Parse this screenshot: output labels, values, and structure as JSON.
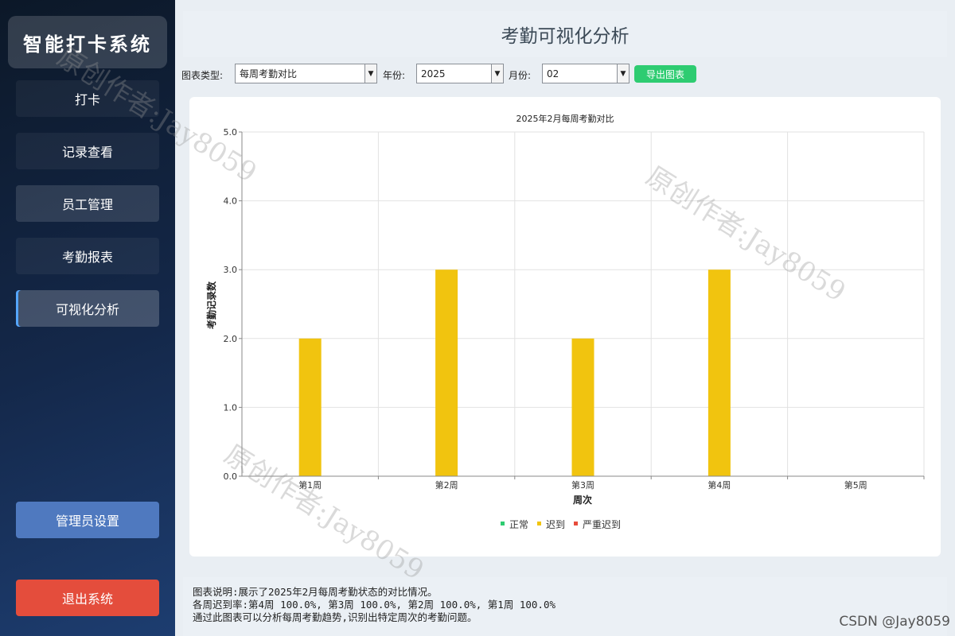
{
  "sidebar": {
    "title": "智能打卡系统",
    "items": [
      {
        "label": "打卡"
      },
      {
        "label": "记录查看"
      },
      {
        "label": "员工管理"
      },
      {
        "label": "考勤报表"
      },
      {
        "label": "可视化分析"
      }
    ],
    "admin_label": "管理员设置",
    "logout_label": "退出系统"
  },
  "header": {
    "title": "考勤可视化分析"
  },
  "toolbar": {
    "chart_type_label": "图表类型:",
    "chart_type_value": "每周考勤对比",
    "year_label": "年份:",
    "year_value": "2025",
    "month_label": "月份:",
    "month_value": "02",
    "export_label": "导出图表"
  },
  "chart_data": {
    "type": "bar",
    "title": "2025年2月每周考勤对比",
    "xlabel": "周次",
    "ylabel": "考勤记录数",
    "categories": [
      "第1周",
      "第2周",
      "第3周",
      "第4周",
      "第5周"
    ],
    "series": [
      {
        "name": "正常",
        "color": "#2ecc71",
        "values": [
          0,
          0,
          0,
          0,
          0
        ]
      },
      {
        "name": "迟到",
        "color": "#f1c40f",
        "values": [
          2,
          3,
          2,
          3,
          0
        ]
      },
      {
        "name": "严重迟到",
        "color": "#e74c3c",
        "values": [
          0,
          0,
          0,
          0,
          0
        ]
      }
    ],
    "ylim": [
      0,
      5
    ],
    "yticks": [
      "0.0",
      "1.0",
      "2.0",
      "3.0",
      "4.0",
      "5.0"
    ],
    "grid": true,
    "legend_position": "bottom"
  },
  "description": {
    "line1": "图表说明:展示了2025年2月每周考勤状态的对比情况。",
    "line2": "各周迟到率:第4周 100.0%, 第3周 100.0%, 第2周 100.0%, 第1周 100.0%",
    "line3": "通过此图表可以分析每周考勤趋势,识别出特定周次的考勤问题。"
  },
  "watermark": {
    "text": "原创作者:Jay8059",
    "csdn": "CSDN @Jay8059"
  }
}
